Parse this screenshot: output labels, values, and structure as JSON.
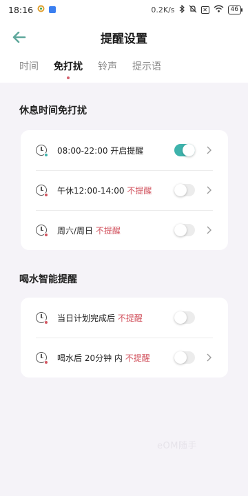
{
  "status_bar": {
    "time": "18:16",
    "network_speed": "0.2K/s",
    "battery": "46"
  },
  "header": {
    "title": "提醒设置"
  },
  "tabs": [
    {
      "label": "时间",
      "active": false
    },
    {
      "label": "免打扰",
      "active": true
    },
    {
      "label": "铃声",
      "active": false
    },
    {
      "label": "提示语",
      "active": false
    }
  ],
  "rest_section": {
    "title": "休息时间免打扰",
    "rows": [
      {
        "prefix": "08:00-22:00 开启提醒",
        "status": "",
        "enabled": true,
        "dot_color": "#3eb3ac"
      },
      {
        "prefix": "午休12:00-14:00 ",
        "status": "不提醒",
        "enabled": false,
        "dot_color": "#d2545f"
      },
      {
        "prefix": "周六/周日 ",
        "status": "不提醒",
        "enabled": false,
        "dot_color": "#d2545f"
      }
    ]
  },
  "drink_section": {
    "title": "喝水智能提醒",
    "rows": [
      {
        "prefix": "当日计划完成后 ",
        "status": "不提醒",
        "enabled": false,
        "dot_color": "#d2545f"
      },
      {
        "prefix": "喝水后 20分钟 内 ",
        "status": "不提醒",
        "enabled": false,
        "dot_color": "#d2545f"
      }
    ]
  },
  "watermark": "eOM随手",
  "colors": {
    "accent": "#3eb3ac",
    "off_text": "#d2545f",
    "background": "#f5f3f8"
  }
}
